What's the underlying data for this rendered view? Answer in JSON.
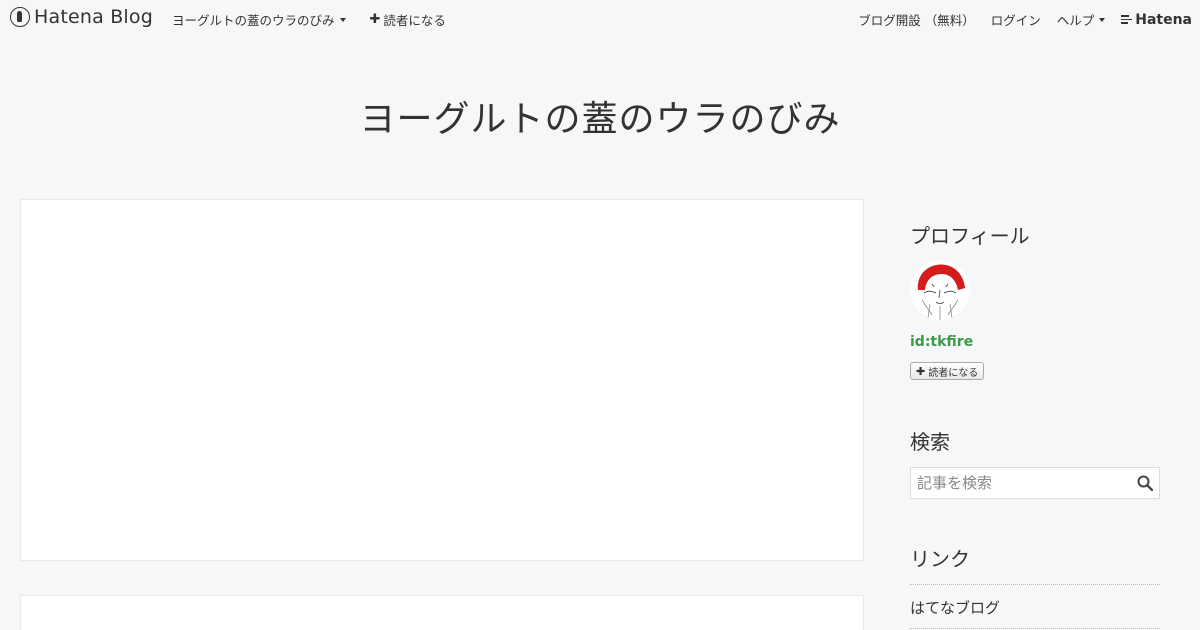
{
  "topbar": {
    "brand": "Hatena Blog",
    "blog_menu": "ヨーグルトの蓋のウラのびみ",
    "subscribe": "読者になる",
    "signup": "ブログ開設 （無料）",
    "login": "ログイン",
    "help": "ヘルプ",
    "hatena": "Hatena"
  },
  "blog": {
    "title": "ヨーグルトの蓋のウラのびみ"
  },
  "sidebar": {
    "profile": {
      "title": "プロフィール",
      "user_id": "id:tkfire",
      "subscribe_label": "読者になる"
    },
    "search": {
      "title": "検索",
      "placeholder": "記事を検索"
    },
    "links": {
      "title": "リンク",
      "items": [
        "はてなブログ"
      ]
    }
  },
  "icons": {
    "brand": "hatena-blog-logo-icon",
    "plus": "plus-icon",
    "caret": "caret-down-icon",
    "search": "search-icon",
    "avatar": "user-avatar"
  },
  "colors": {
    "background": "#f6f7f8",
    "user_id": "#3a9a48",
    "text": "#333333"
  }
}
